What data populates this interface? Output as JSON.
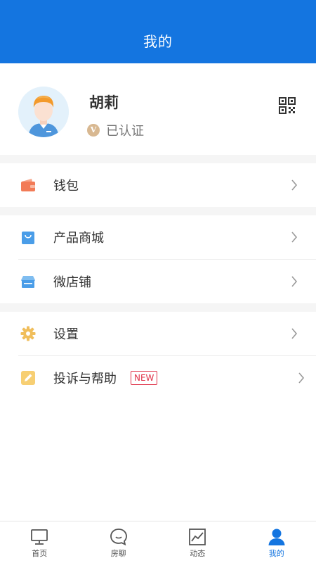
{
  "header": {
    "title": "我的"
  },
  "profile": {
    "name": "胡莉",
    "verify_badge": "V",
    "verify_text": "已认证"
  },
  "menu": {
    "wallet": "钱包",
    "mall": "产品商城",
    "shop": "微店铺",
    "settings": "设置",
    "help": "投诉与帮助",
    "new_badge": "NEW"
  },
  "tabs": [
    {
      "label": "首页",
      "icon": "monitor-icon"
    },
    {
      "label": "房聊",
      "icon": "chat-icon"
    },
    {
      "label": "动态",
      "icon": "trend-icon"
    },
    {
      "label": "我的",
      "icon": "person-icon",
      "active": true
    }
  ],
  "colors": {
    "primary": "#1475e0",
    "wallet": "#f27b57",
    "mall": "#4a9de8",
    "settings": "#f0be5c",
    "new_badge": "#e0344a",
    "verify": "#d8b891"
  }
}
